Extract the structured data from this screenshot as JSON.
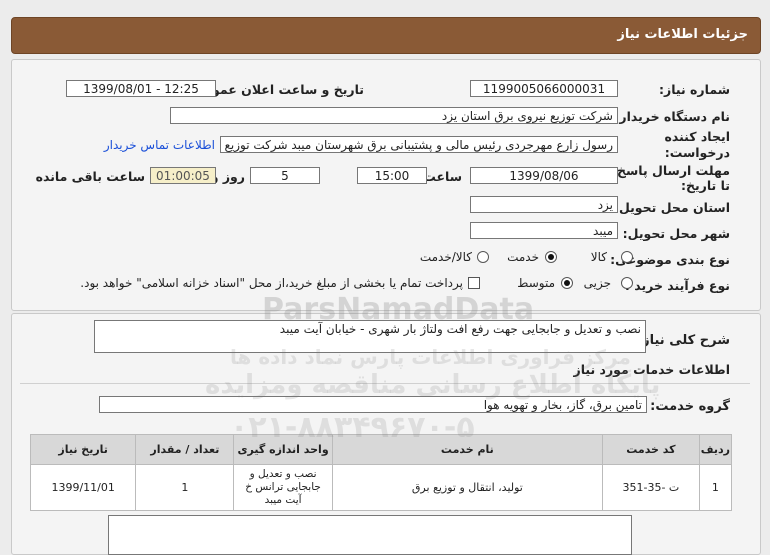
{
  "header": {
    "title": "جزئیات اطلاعات نیاز"
  },
  "fields": {
    "need_number_label": "شماره نیاز:",
    "need_number": "1199005066000031",
    "announce_label": "تاریخ و ساعت اعلان عمومی:",
    "announce_value": "1399/08/01 - 12:25",
    "buyer_label": "نام دستگاه خریدار:",
    "buyer_value": "شرکت توزیع نیروی برق استان یزد",
    "creator_label_1": "ایجاد کننده",
    "creator_label_2": "درخواست:",
    "creator_value": "رسول  زارع مهرجردی  رئیس مالی و پشتیبانی برق شهرستان میبد شرکت توزیع",
    "contact_link": "اطلاعات تماس خریدار",
    "deadline_label_1": "مهلت ارسال پاسخ:",
    "deadline_label_2": "تا تاریخ:",
    "deadline_date": "1399/08/06",
    "time_label": "ساعت",
    "deadline_time": "15:00",
    "days_value": "5",
    "days_label": "روز و",
    "remaining_time": "01:00:05",
    "remaining_label": "ساعت باقی مانده",
    "province_label": "استان محل تحویل:",
    "province_value": "یزد",
    "city_label": "شهر محل تحویل:",
    "city_value": "میبد",
    "category_label": "نوع بندی موضوعی:",
    "category_options": [
      "کالا",
      "خدمت",
      "کالا/خدمت"
    ],
    "process_label": "نوع فرآیند خرید :",
    "process_options": [
      "جزیی",
      "متوسط"
    ],
    "payment_text": "پرداخت تمام یا بخشی از مبلغ خرید،از محل \"اسناد خزانه اسلامی\" خواهد بود."
  },
  "summary": {
    "label": "شرح کلی نیاز:",
    "value": "نصب و تعدیل و جابجایی جهت رفع افت ولتاژ بار شهری - خیابان آیت میبد",
    "services_title": "اطلاعات خدمات مورد نیاز",
    "group_label": "گروه خدمت:",
    "group_value": "تامین برق، گاز، بخار و تهویه هوا"
  },
  "table": {
    "headers": [
      "ردیف",
      "کد خدمت",
      "نام خدمت",
      "واحد اندازه گیری",
      "تعداد / مقدار",
      "تاریخ نیاز"
    ],
    "rows": [
      [
        "1",
        "ت -35-351",
        "تولید، انتقال و توزیع برق",
        "نصب و تعدیل و جابجایی ترانس خ آیت میبد",
        "1",
        "1399/11/01"
      ]
    ]
  },
  "watermark": {
    "brand": "ParsNamadData",
    "line1": "مرکز فراوری اطلاعات پارس نماد داده ها",
    "line2": "پایگاه اطلاع رسانی مناقصه ومزایده",
    "phone": "۰۲۱-۸۸۳۴۹۶۷۰-۵"
  }
}
